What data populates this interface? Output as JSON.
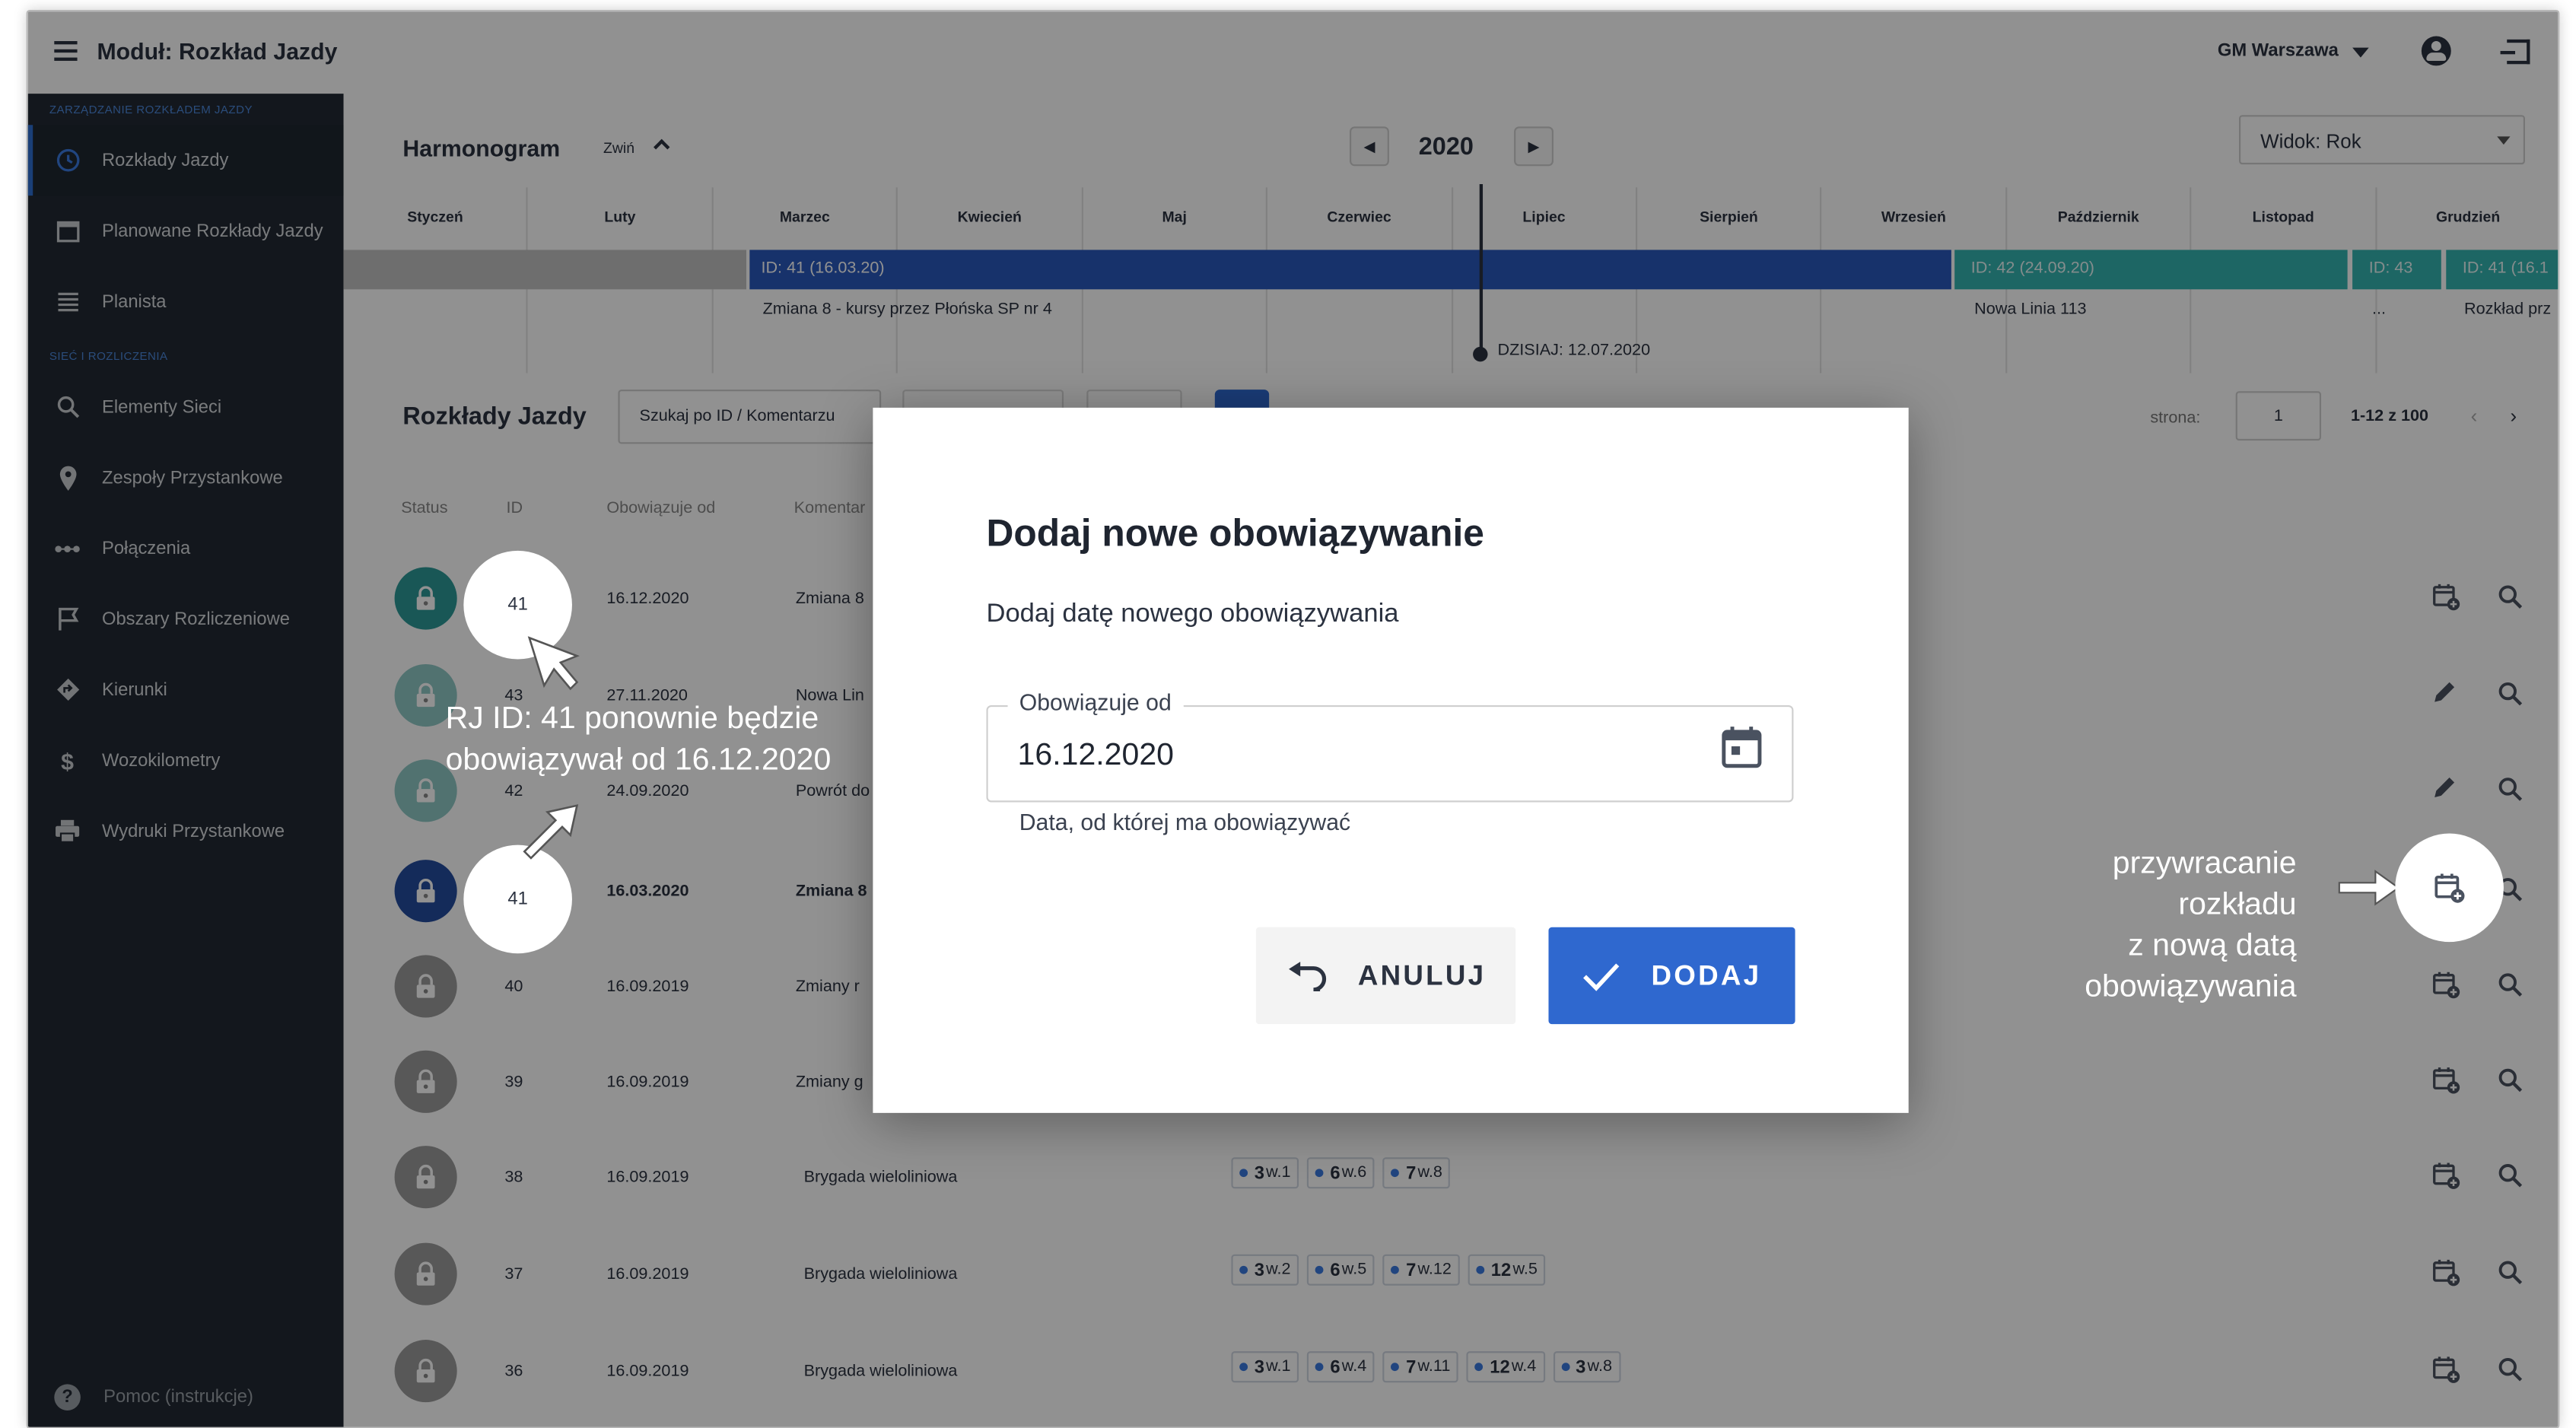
{
  "app": {
    "title": "Moduł: Rozkład Jazdy",
    "org": "GM Warszawa"
  },
  "sidebar": {
    "section1": "ZARZĄDZANIE ROZKŁADEM JAZDY",
    "items1": [
      {
        "label": "Rozkłady Jazdy",
        "icon": "clock-icon"
      },
      {
        "label": "Planowane Rozkłady Jazdy",
        "icon": "calendar-icon"
      },
      {
        "label": "Planista",
        "icon": "list-icon"
      }
    ],
    "section2": "SIEĆ I ROZLICZENIA",
    "items2": [
      {
        "label": "Elementy Sieci",
        "icon": "search-icon"
      },
      {
        "label": "Zespoły Przystankowe",
        "icon": "pin-icon"
      },
      {
        "label": "Połączenia",
        "icon": "dots-icon"
      },
      {
        "label": "Obszary Rozliczeniowe",
        "icon": "flag-icon"
      },
      {
        "label": "Kierunki",
        "icon": "direction-icon"
      },
      {
        "label": "Wozokilometry",
        "icon": "dollar-icon"
      },
      {
        "label": "Wydruki Przystankowe",
        "icon": "printer-icon"
      }
    ],
    "help": "Pomoc (instrukcje)"
  },
  "harmonogram": {
    "title": "Harmonogram",
    "collapse": "Zwiń",
    "year": "2020",
    "view": "Widok: Rok",
    "months": [
      "Styczeń",
      "Luty",
      "Marzec",
      "Kwiecień",
      "Maj",
      "Czerwiec",
      "Lipiec",
      "Sierpień",
      "Wrzesień",
      "Październik",
      "Listopad",
      "Grudzień"
    ],
    "bars": {
      "blue": "ID: 41 (16.03.20)",
      "teal1": "ID: 42 (24.09.20)",
      "teal2": "ID: 43",
      "teal3": "ID: 41 (16.1"
    },
    "bar_texts": {
      "blue": "Zmiana 8 - kursy przez Płońska SP nr 4",
      "teal1": "Nowa Linia 113",
      "teal2": "...",
      "teal3": "Rozkład prz"
    },
    "today": "DZISIAJ: 12.07.2020"
  },
  "list": {
    "title": "Rozkłady Jazdy",
    "search_placeholder": "Szukaj po ID / Komentarzu",
    "page_label": "strona:",
    "page": "1",
    "range": "1-12 z 100",
    "headers": {
      "status": "Status",
      "id": "ID",
      "from": "Obowiązuje od",
      "comment": "Komentar"
    },
    "rows": [
      {
        "id": "41",
        "date": "16.12.2020",
        "comment": "Zmiana 8",
        "lock": "teal",
        "action": "calendar",
        "chips": []
      },
      {
        "id": "43",
        "date": "27.11.2020",
        "comment": "Nowa Lin",
        "lock": "teal-light",
        "action": "edit",
        "chips": []
      },
      {
        "id": "42",
        "date": "24.09.2020",
        "comment": "Powrót do",
        "lock": "teal-light",
        "action": "edit",
        "chips": []
      },
      {
        "id": "41",
        "date": "16.03.2020",
        "comment": "Zmiana 8",
        "lock": "navy",
        "action": "calendar",
        "chips": []
      },
      {
        "id": "40",
        "date": "16.09.2019",
        "comment": "Zmiany r",
        "lock": "grey",
        "action": "calendar",
        "chips": []
      },
      {
        "id": "39",
        "date": "16.09.2019",
        "comment": "Zmiany g",
        "lock": "grey",
        "action": "calendar",
        "chips": []
      },
      {
        "id": "38",
        "date": "16.09.2019",
        "comment": "Brygada wieloliniowa",
        "lock": "grey",
        "action": "calendar",
        "chips": [
          {
            "n": "3",
            "w": "w.1"
          },
          {
            "n": "6",
            "w": "w.6"
          },
          {
            "n": "7",
            "w": "w.8"
          }
        ]
      },
      {
        "id": "37",
        "date": "16.09.2019",
        "comment": "Brygada wieloliniowa",
        "lock": "grey",
        "action": "calendar",
        "chips": [
          {
            "n": "3",
            "w": "w.2"
          },
          {
            "n": "6",
            "w": "w.5"
          },
          {
            "n": "7",
            "w": "w.12"
          },
          {
            "n": "12",
            "w": "w.5"
          }
        ]
      },
      {
        "id": "36",
        "date": "16.09.2019",
        "comment": "Brygada wieloliniowa",
        "lock": "grey",
        "action": "calendar",
        "chips": [
          {
            "n": "3",
            "w": "w.1"
          },
          {
            "n": "6",
            "w": "w.4"
          },
          {
            "n": "7",
            "w": "w.11"
          },
          {
            "n": "12",
            "w": "w.4"
          },
          {
            "n": "3",
            "w": "w.8"
          }
        ]
      }
    ]
  },
  "annotations": {
    "left_line1": "RJ ID: 41 ponownie będzie",
    "left_line2": "obowiązywał od 16.12.2020",
    "right_lines": [
      "przywracanie",
      "rozkładu",
      "z nową datą",
      "obowiązywania"
    ],
    "circle_top": "41",
    "circle_bottom": "41"
  },
  "dialog": {
    "title": "Dodaj nowe obowiązywanie",
    "subtitle": "Dodaj datę nowego obowiązywania",
    "field_label": "Obowiązuje od",
    "field_value": "16.12.2020",
    "helper": "Data, od której ma obowiązywać",
    "cancel": "ANULUJ",
    "add": "DODAJ"
  },
  "colors": {
    "primary": "#2f68cf",
    "navy": "#244c9e",
    "teal": "#2d9a97",
    "sidebar": "#232a33"
  }
}
